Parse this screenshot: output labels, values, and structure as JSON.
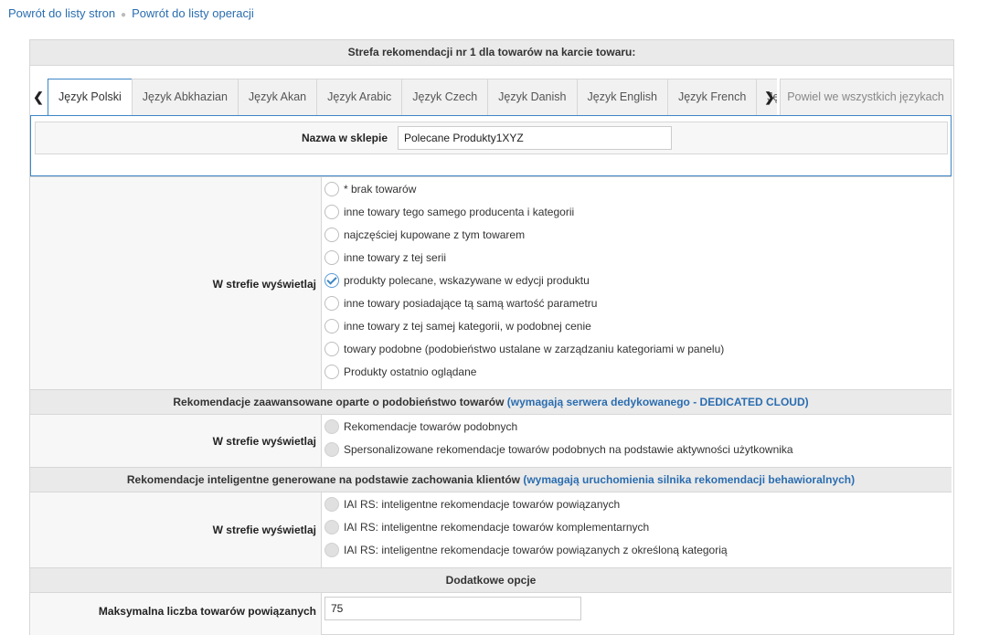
{
  "breadcrumb": {
    "link1": "Powrót do listy stron",
    "link2": "Powrót do listy operacji"
  },
  "panel": {
    "title": "Strefa rekomendacji nr 1 dla towarów na karcie towaru:"
  },
  "tabs": {
    "items": [
      "Język Polski",
      "Język Abkhazian",
      "Język Akan",
      "Język Arabic",
      "Język Czech",
      "Język Danish",
      "Język English",
      "Język French",
      "Język Galician"
    ],
    "active": "Język Polski",
    "repeat_all": "Powiel we wszystkich językach",
    "prev_icon": "chevron-left-icon",
    "next_icon": "chevron-right-icon"
  },
  "shop_name": {
    "label": "Nazwa w sklepie",
    "value": "Polecane Produkty1XYZ"
  },
  "display": {
    "label": "W strefie wyświetlaj",
    "options": [
      "* brak towarów",
      "inne towary tego samego producenta i kategorii",
      "najczęściej kupowane z tym towarem",
      "inne towary z tej serii",
      "produkty polecane, wskazywane w edycji produktu",
      "inne towary posiadające tą samą wartość parametru",
      "inne towary z tej samej kategorii, w podobnej cenie",
      "towary podobne (podobieństwo ustalane w zarządzaniu kategoriami w panelu)",
      "Produkty ostatnio oglądane"
    ],
    "selected": "produkty polecane, wskazywane w edycji produktu"
  },
  "advanced": {
    "title": "Rekomendacje zaawansowane oparte o podobieństwo towarów",
    "note": "(wymagają serwera dedykowanego - DEDICATED CLOUD)",
    "label": "W strefie wyświetlaj",
    "options": [
      "Rekomendacje towarów podobnych",
      "Spersonalizowane rekomendacje towarów podobnych na podstawie aktywności użytkownika"
    ]
  },
  "intelligent": {
    "title": "Rekomendacje inteligentne generowane na podstawie zachowania klientów",
    "note": "(wymagają uruchomienia silnika rekomendacji behawioralnych)",
    "label": "W strefie wyświetlaj",
    "options": [
      "IAI RS: inteligentne rekomendacje towarów powiązanych",
      "IAI RS: inteligentne rekomendacje towarów komplementarnych",
      "IAI RS: inteligentne rekomendacje towarów powiązanych z określoną kategorią"
    ]
  },
  "extra": {
    "title": "Dodatkowe opcje",
    "max_label": "Maksymalna liczba towarów powiązanych",
    "max_value": "75"
  },
  "colors": {
    "link": "#2a6db0",
    "tab_active_border": "#3d86c6",
    "header_bg": "#eaeaea"
  }
}
